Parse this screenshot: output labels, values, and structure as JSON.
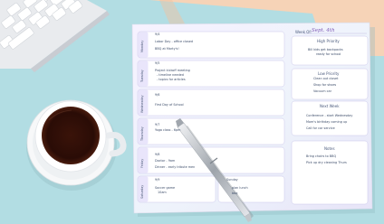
{
  "planner": {
    "week_label": "Week Of:",
    "week_value": "Sept. 4th",
    "days": [
      {
        "name": "Monday",
        "tag": "9/4",
        "lines": [
          "Labor Day - office closed",
          "BBQ at Marty's!"
        ]
      },
      {
        "name": "Tuesday",
        "tag": "9/5",
        "lines": [
          "Project kickoff meeting",
          "- timeline needed",
          "- topics for articles"
        ]
      },
      {
        "name": "Wednesday",
        "tag": "9/6",
        "lines": [
          "First Day of School"
        ]
      },
      {
        "name": "Thursday",
        "tag": "9/7",
        "lines": [
          "Yoga class - 6pm"
        ]
      },
      {
        "name": "Friday",
        "tag": "9/8",
        "lines": [
          "Doctor - 9am",
          "Dinner - early tribute men"
        ]
      },
      {
        "name": "Saturday",
        "tag": "9/9",
        "lines": [
          "Soccer game",
          "10am"
        ]
      }
    ],
    "sunday_lines": [
      "Sunday",
      "plan lunch",
      "bbq"
    ],
    "sections": [
      {
        "title": "High Priority",
        "lines": [
          "Bill kids get backpacks",
          "ready for school"
        ]
      },
      {
        "title": "Low Priority",
        "lines": [
          "Clean out closet",
          "Shop for shoes",
          "Vacuum car"
        ]
      },
      {
        "title": "Next Week",
        "lines": [
          "Conference - start Wednesday",
          "Mom's birthday coming up",
          "Call for car service"
        ]
      },
      {
        "title": "Notes",
        "lines": [
          "Bring chairs to BBQ",
          "Pick up dry cleaning Thurs"
        ]
      }
    ]
  },
  "colors": {
    "background": "#b2dde3",
    "peach": "#f7d6bd",
    "paper": "#f4f6fb",
    "lavender": "#c8c2ee",
    "cup_rim": "#ffffff",
    "coffee": "#2e0f08",
    "keyboard": "#e8eaee",
    "pen_silver": "#d7dbe0"
  },
  "objects": {
    "keyboard": "keyboard",
    "coffee_cup": "coffee-cup",
    "saucer": "saucer",
    "pen": "pen",
    "planner": "planner-sheet"
  }
}
